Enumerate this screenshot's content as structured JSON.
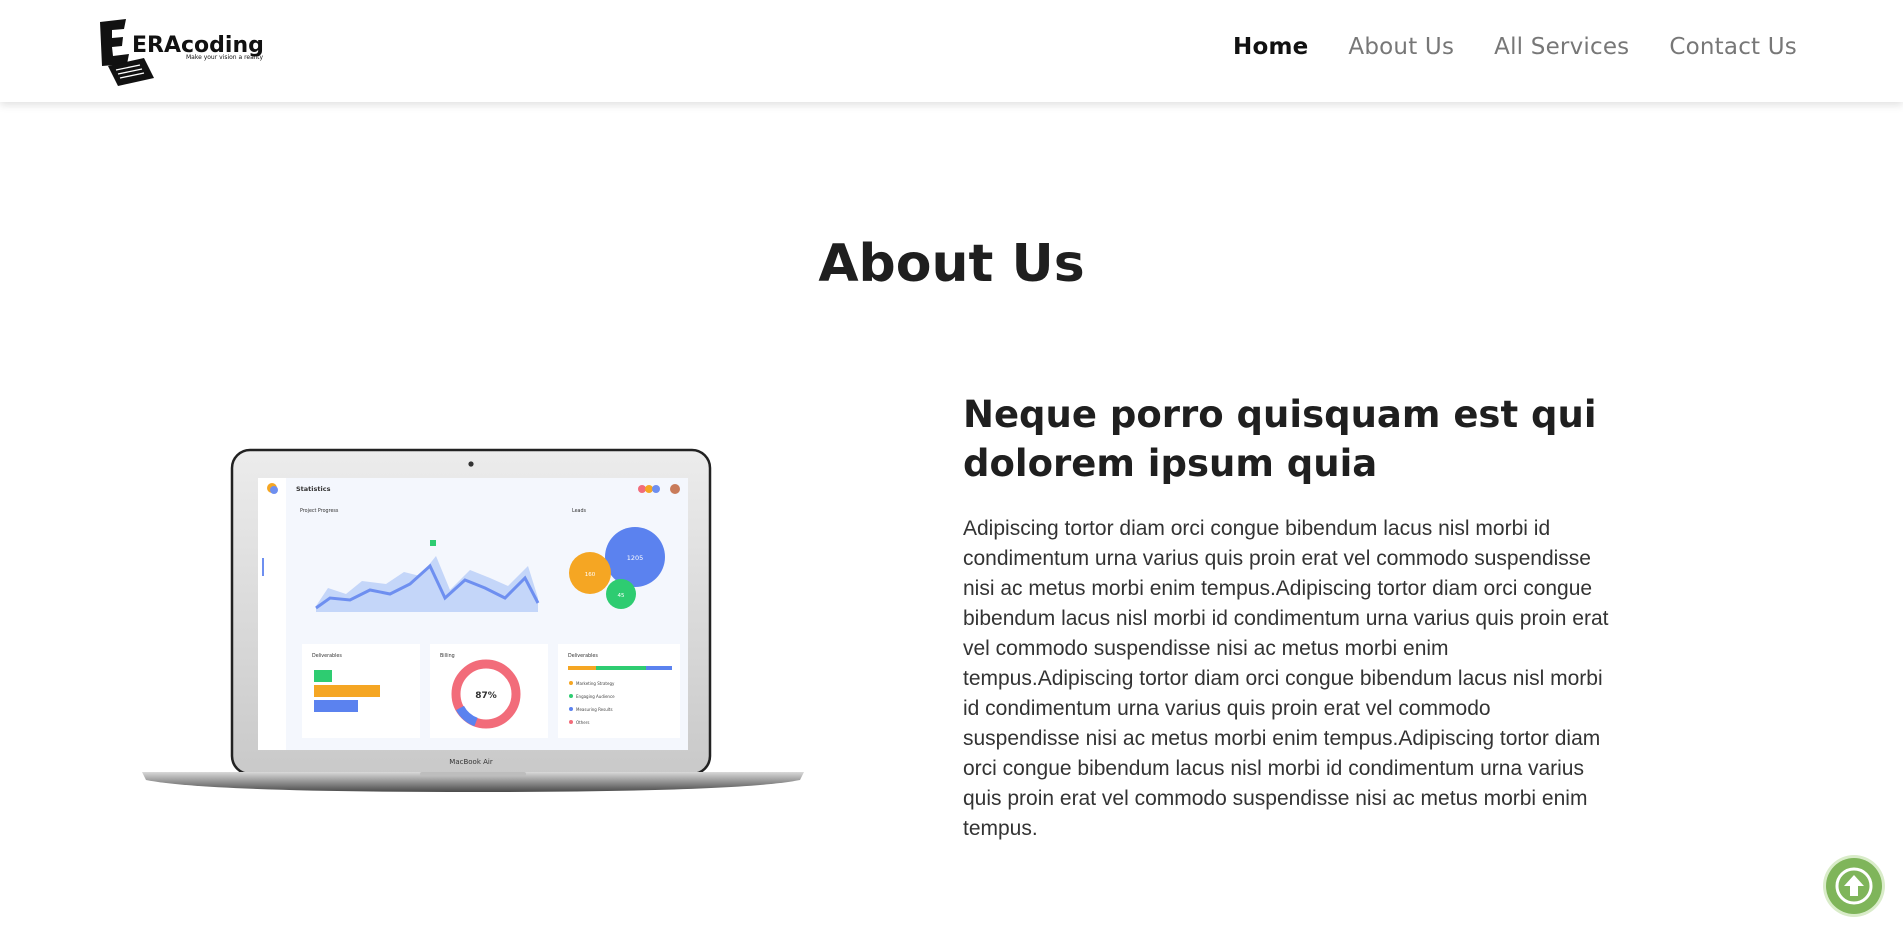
{
  "brand": {
    "logo_text": "ERAcoding",
    "tagline": "Make your vision a reality"
  },
  "nav": {
    "items": [
      {
        "label": "Home",
        "active": true
      },
      {
        "label": "About Us",
        "active": false
      },
      {
        "label": "All Services",
        "active": false
      },
      {
        "label": "Contact Us",
        "active": false
      }
    ]
  },
  "about": {
    "title": "About Us",
    "heading": "Neque porro quisquam est qui dolorem ipsum quia",
    "body": "Adipiscing tortor diam orci congue bibendum lacus nisl morbi id condimentum urna varius quis proin erat vel commodo suspendisse nisi ac metus morbi enim tempus.Adipiscing tortor diam orci congue bibendum lacus nisl morbi id condimentum urna varius quis proin erat vel commodo suspendisse nisi ac metus morbi enim tempus.Adipiscing tortor diam orci congue bibendum lacus nisl morbi id condimentum urna varius quis proin erat vel commodo suspendisse nisi ac metus morbi enim tempus.Adipiscing tortor diam orci congue bibendum lacus nisl morbi id condimentum urna varius quis proin erat vel commodo suspendisse nisi ac metus morbi enim tempus."
  },
  "laptop_screen": {
    "app_title": "Statistics",
    "panel_progress": "Project Progress",
    "panel_leads": "Leads",
    "leads_values": [
      "1205",
      "160",
      "45"
    ],
    "panel_deliverables": "Deliverables",
    "panel_billing": "Billing",
    "billing_percent": "87%",
    "panel_deliverables_list": "Deliverables",
    "list_items": [
      "Marketing Strategy",
      "Engaging Audience",
      "Measuring Results",
      "Others"
    ],
    "device_label": "MacBook Air"
  },
  "scroll_top": {
    "icon": "arrow-up-icon"
  },
  "colors": {
    "accent_green": "#7fb55a",
    "chart_blue": "#6e8ff0",
    "chart_orange": "#f5a623",
    "chart_green": "#2ecc71",
    "chart_red": "#f26c7a"
  }
}
